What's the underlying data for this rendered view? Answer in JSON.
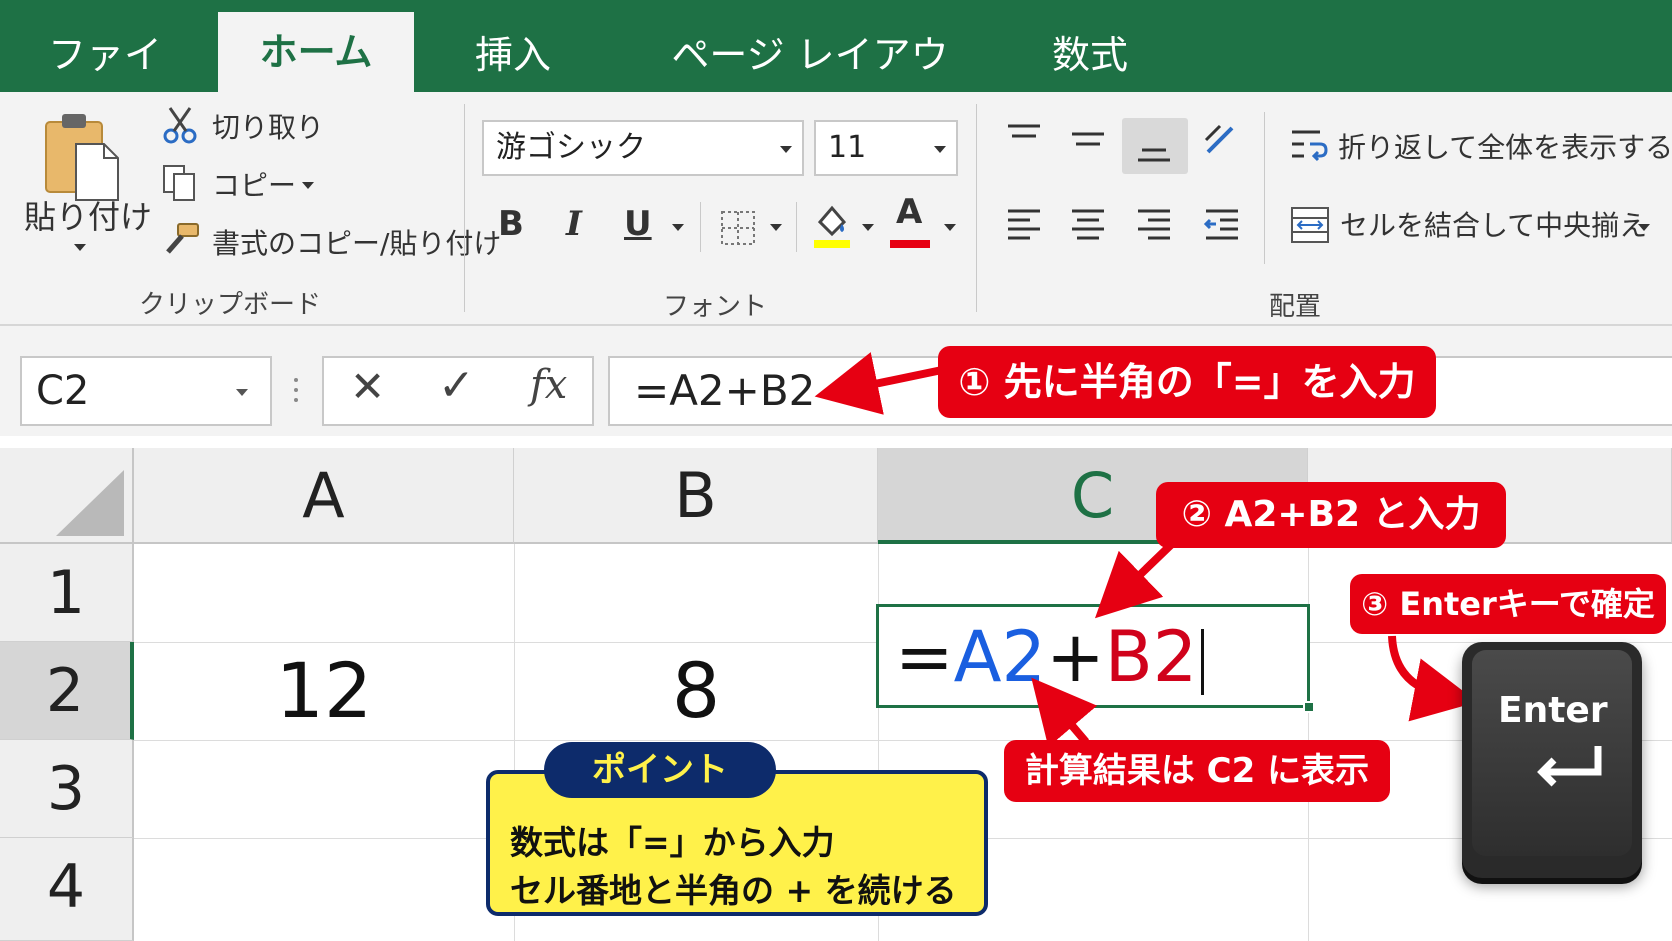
{
  "tabs": [
    "ファイル",
    "ホーム",
    "挿入",
    "ページ レイアウト",
    "数式"
  ],
  "active_tab": "ホーム",
  "clipboard": {
    "paste_label": "貼り付け",
    "cut_label": "切り取り",
    "copy_label": "コピー",
    "format_painter_label": "書式のコピー/貼り付け",
    "group_label": "クリップボード"
  },
  "font": {
    "font_name": "游ゴシック",
    "font_size": "11",
    "bold_label": "B",
    "italic_label": "I",
    "underline_label": "U",
    "font_color_label": "A",
    "group_label": "フォント",
    "fill_color": "#ffff00",
    "text_color": "#e60012"
  },
  "alignment": {
    "wrap_text_label": "折り返して全体を表示する",
    "merge_center_label": "セルを結合して中央揃え",
    "group_label": "配置"
  },
  "formula_bar": {
    "name_box": "C2",
    "cancel_symbol": "✕",
    "enter_symbol": "✓",
    "fx_label": "fx",
    "formula": "=A2+B2"
  },
  "grid": {
    "columns": [
      "A",
      "B",
      "C"
    ],
    "rows": [
      "1",
      "2",
      "3",
      "4"
    ],
    "selected_column": "C",
    "selected_row": "2",
    "cells": {
      "A2": "12",
      "B2": "8"
    },
    "edit_formula": {
      "eq": "=",
      "ref1": "A2",
      "plus": "+",
      "ref2": "B2",
      "ref1_color": "#1a5fe0",
      "ref2_color": "#d0021b"
    }
  },
  "callouts": {
    "step1": "① 先に半角の「=」を入力",
    "step2": "② A2+B2 と入力",
    "step3": "③ Enterキーで確定",
    "result": "計算結果は C2 に表示"
  },
  "point_box": {
    "title": "ポイント",
    "line1": "数式は「=」から入力",
    "line2": "セル番地と半角の + を続ける"
  },
  "enter_key": {
    "label": "Enter",
    "symbol": "⏎"
  },
  "colors": {
    "excel_green": "#1e7145",
    "callout_red": "#e60012",
    "point_yellow": "#fff14a",
    "point_navy": "#0d2b6b"
  }
}
